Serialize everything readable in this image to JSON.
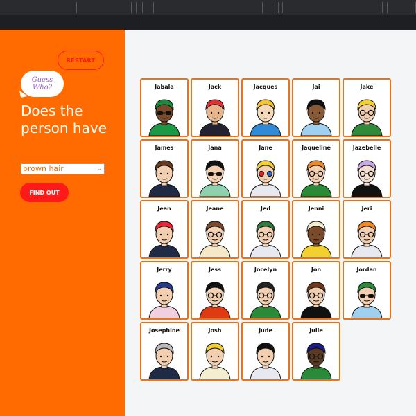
{
  "app": {
    "restart_label": "RESTART",
    "logo_line1": "Guess",
    "logo_line2": "Who?",
    "question": "Does the person have",
    "selected_trait": "brown hair",
    "find_out_label": "FIND OUT"
  },
  "colors": {
    "panel": "#ff6b00",
    "accent_red": "#ff1a1a",
    "card_border": "#e8731a"
  },
  "people": [
    {
      "name": "Jabala",
      "skin": "#7a4a2a",
      "hair": "#1c8a3a",
      "shirt": "#1a9a44",
      "glasses": "sun"
    },
    {
      "name": "Jack",
      "skin": "#e8b58a",
      "hair": "#d33",
      "shirt": "#223",
      "glasses": "none"
    },
    {
      "name": "Jacques",
      "skin": "#f3d9b8",
      "hair": "#f2c230",
      "shirt": "#2f8bd8",
      "glasses": "none"
    },
    {
      "name": "Jai",
      "skin": "#8a5a34",
      "hair": "#111",
      "shirt": "#9fd0f0",
      "glasses": "none"
    },
    {
      "name": "Jake",
      "skin": "#f2cfb0",
      "hair": "#f2d030",
      "shirt": "#2f8a3a",
      "glasses": "clear"
    },
    {
      "name": "James",
      "skin": "#f2cfb0",
      "hair": "#6b3a1a",
      "shirt": "#1f2a44",
      "glasses": "none"
    },
    {
      "name": "Jana",
      "skin": "#f2cfb0",
      "hair": "#111",
      "shirt": "#8fd0b0",
      "glasses": "sun"
    },
    {
      "name": "Jane",
      "skin": "#f2cfb0",
      "hair": "#f2d030",
      "shirt": "#e8e8f0",
      "glasses": "3d"
    },
    {
      "name": "Jaqueline",
      "skin": "#f2cfb0",
      "hair": "#f08a20",
      "shirt": "#2a8a3a",
      "glasses": "clear"
    },
    {
      "name": "Jazebelle",
      "skin": "#f4e0d0",
      "hair": "#c9a8e8",
      "shirt": "#111",
      "glasses": "clear"
    },
    {
      "name": "Jean",
      "skin": "#f2cfb0",
      "hair": "#e23",
      "shirt": "#1f2a44",
      "glasses": "none"
    },
    {
      "name": "Jeane",
      "skin": "#f2cfb0",
      "hair": "#7a4a2a",
      "shirt": "#f4e8c8",
      "glasses": "clear"
    },
    {
      "name": "Jed",
      "skin": "#f2cfb0",
      "hair": "#2f7a3a",
      "shirt": "#e8e8f0",
      "glasses": "clear"
    },
    {
      "name": "Jenni",
      "skin": "#7a4a2a",
      "hair": "#f4eed0",
      "shirt": "#f2d030",
      "glasses": "none"
    },
    {
      "name": "Jeri",
      "skin": "#f2cfb0",
      "hair": "#f08a20",
      "shirt": "#e8e8f0",
      "glasses": "clear"
    },
    {
      "name": "Jerry",
      "skin": "#f2cfb0",
      "hair": "#223a88",
      "shirt": "#f0d0e0",
      "glasses": "none"
    },
    {
      "name": "Jess",
      "skin": "#f2cfb0",
      "hair": "#111",
      "shirt": "#e23a10",
      "glasses": "clear"
    },
    {
      "name": "Jocelyn",
      "skin": "#f2cfb0",
      "hair": "#222",
      "shirt": "#2a8a3a",
      "glasses": "clear"
    },
    {
      "name": "Jon",
      "skin": "#f2cfb0",
      "hair": "#6b3a1a",
      "shirt": "#111",
      "glasses": "clear"
    },
    {
      "name": "Jordan",
      "skin": "#f2cfb0",
      "hair": "#2a8a3a",
      "shirt": "#9fd0f0",
      "glasses": "sun"
    },
    {
      "name": "Josephine",
      "skin": "#f2cfb0",
      "hair": "#bbbbbb",
      "shirt": "#1f2a44",
      "glasses": "none"
    },
    {
      "name": "Josh",
      "skin": "#f2cfb0",
      "hair": "#f2d030",
      "shirt": "#f4eed0",
      "glasses": "none"
    },
    {
      "name": "Jude",
      "skin": "#f2cfb0",
      "hair": "#111",
      "shirt": "#e8e8f0",
      "glasses": "none"
    },
    {
      "name": "Julie",
      "skin": "#5a3a22",
      "hair": "#1a1a8a",
      "shirt": "#2a8a3a",
      "glasses": "clear"
    }
  ]
}
